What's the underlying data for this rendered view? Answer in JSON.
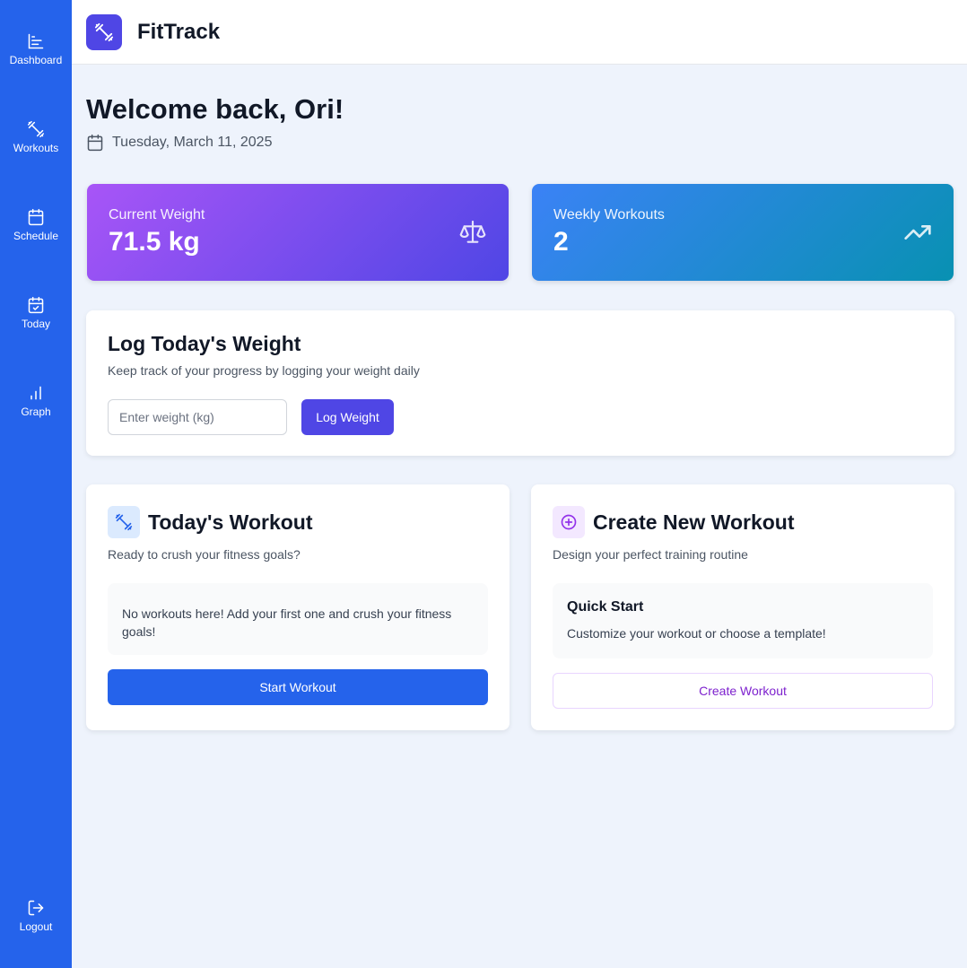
{
  "app": {
    "title": "FitTrack",
    "logo_icon": "dumbbell-icon"
  },
  "sidebar": {
    "items": [
      {
        "label": "Dashboard",
        "icon": "bar-chart-icon"
      },
      {
        "label": "Workouts",
        "icon": "dumbbell-icon"
      },
      {
        "label": "Schedule",
        "icon": "calendar-icon"
      },
      {
        "label": "Today",
        "icon": "calendar-check-icon"
      },
      {
        "label": "Graph",
        "icon": "graph-icon"
      }
    ],
    "logout": {
      "label": "Logout",
      "icon": "logout-icon"
    }
  },
  "welcome": {
    "heading": "Welcome back, Ori!",
    "date": "Tuesday, March 11, 2025"
  },
  "stats": {
    "weight": {
      "label": "Current Weight",
      "value": "71.5 kg",
      "icon": "scale-icon"
    },
    "workouts": {
      "label": "Weekly Workouts",
      "value": "2",
      "icon": "trending-up-icon"
    }
  },
  "log_weight": {
    "title": "Log Today's Weight",
    "subtitle": "Keep track of your progress by logging your weight daily",
    "input_placeholder": "Enter weight (kg)",
    "button": "Log Weight"
  },
  "todays_workout": {
    "title": "Today's Workout",
    "subtitle": "Ready to crush your fitness goals?",
    "empty_text": "No workouts here! Add your first one and crush your fitness goals!",
    "button": "Start Workout"
  },
  "create_workout": {
    "title": "Create New Workout",
    "subtitle": "Design your perfect training routine",
    "quick_title": "Quick Start",
    "quick_text": "Customize your workout or choose a template!",
    "button": "Create Workout"
  },
  "colors": {
    "sidebar": "#2563eb",
    "primary": "#4f46e5",
    "weight_gradient": [
      "#a855f7",
      "#4f46e5"
    ],
    "workouts_gradient": [
      "#3b82f6",
      "#0891b2"
    ],
    "create_accent": "#7e22ce"
  }
}
